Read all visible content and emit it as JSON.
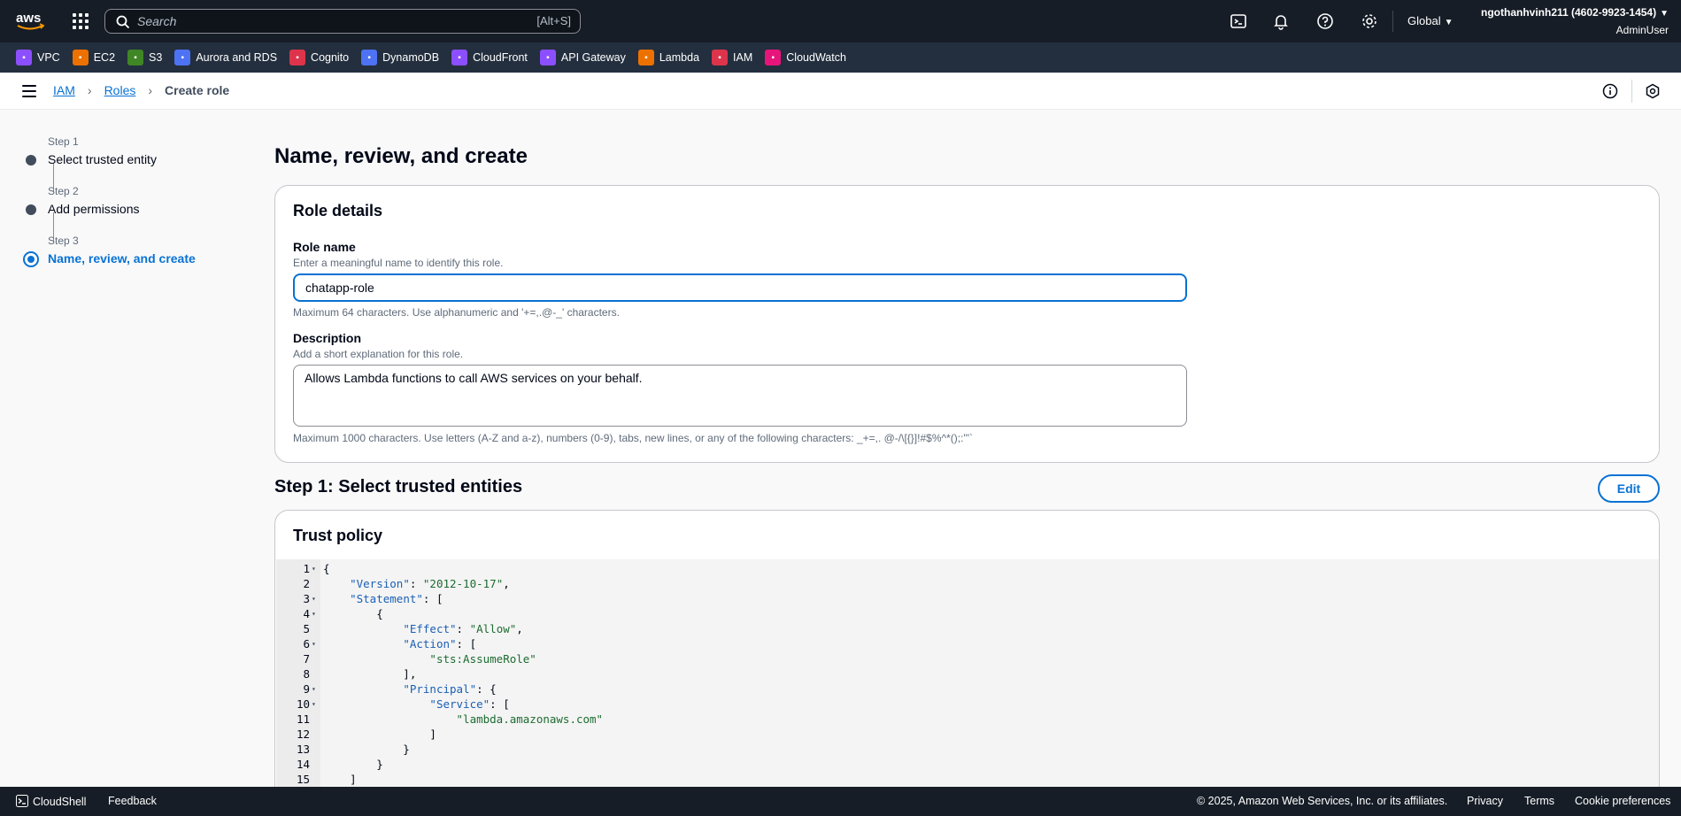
{
  "topnav": {
    "logo_text": "aws",
    "search_placeholder": "Search",
    "search_shortcut": "[Alt+S]",
    "region": "Global",
    "account_name": "ngothanhvinh211 (4602-9923-1454)",
    "user": "AdminUser"
  },
  "favorites": [
    {
      "label": "VPC",
      "color": "#8c4fff"
    },
    {
      "label": "EC2",
      "color": "#ed7100"
    },
    {
      "label": "S3",
      "color": "#3f8624"
    },
    {
      "label": "Aurora and RDS",
      "color": "#4d72f3"
    },
    {
      "label": "Cognito",
      "color": "#dd344c"
    },
    {
      "label": "DynamoDB",
      "color": "#4d72f3"
    },
    {
      "label": "CloudFront",
      "color": "#8c4fff"
    },
    {
      "label": "API Gateway",
      "color": "#8c4fff"
    },
    {
      "label": "Lambda",
      "color": "#ed7100"
    },
    {
      "label": "IAM",
      "color": "#dd344c"
    },
    {
      "label": "CloudWatch",
      "color": "#e7157b"
    }
  ],
  "breadcrumb": {
    "items": [
      "IAM",
      "Roles"
    ],
    "current": "Create role"
  },
  "steps": [
    {
      "num": "Step 1",
      "label": "Select trusted entity"
    },
    {
      "num": "Step 2",
      "label": "Add permissions"
    },
    {
      "num": "Step 3",
      "label": "Name, review, and create"
    }
  ],
  "page_title": "Name, review, and create",
  "role_details": {
    "title": "Role details",
    "role_name_label": "Role name",
    "role_name_desc": "Enter a meaningful name to identify this role.",
    "role_name_value": "chatapp-role",
    "role_name_hint": "Maximum 64 characters. Use alphanumeric and '+=,.@-_' characters.",
    "description_label": "Description",
    "description_desc": "Add a short explanation for this role.",
    "description_value": "Allows Lambda functions to call AWS services on your behalf.",
    "description_hint": "Maximum 1000 characters. Use letters (A-Z and a-z), numbers (0-9), tabs, new lines, or any of the following characters: _+=,. @-/\\[{}]!#$%^*();:\"'`"
  },
  "step1_section": {
    "title": "Step 1: Select trusted entities",
    "edit_label": "Edit",
    "trust_policy_title": "Trust policy"
  },
  "trust_policy_lines": [
    "{",
    "    \"Version\": \"2012-10-17\",",
    "    \"Statement\": [",
    "        {",
    "            \"Effect\": \"Allow\",",
    "            \"Action\": [",
    "                \"sts:AssumeRole\"",
    "            ],",
    "            \"Principal\": {",
    "                \"Service\": [",
    "                    \"lambda.amazonaws.com\"",
    "                ]",
    "            }",
    "        }",
    "    ]"
  ],
  "footer": {
    "cloudshell": "CloudShell",
    "feedback": "Feedback",
    "copyright": "© 2025, Amazon Web Services, Inc. or its affiliates.",
    "privacy": "Privacy",
    "terms": "Terms",
    "cookies": "Cookie preferences"
  }
}
